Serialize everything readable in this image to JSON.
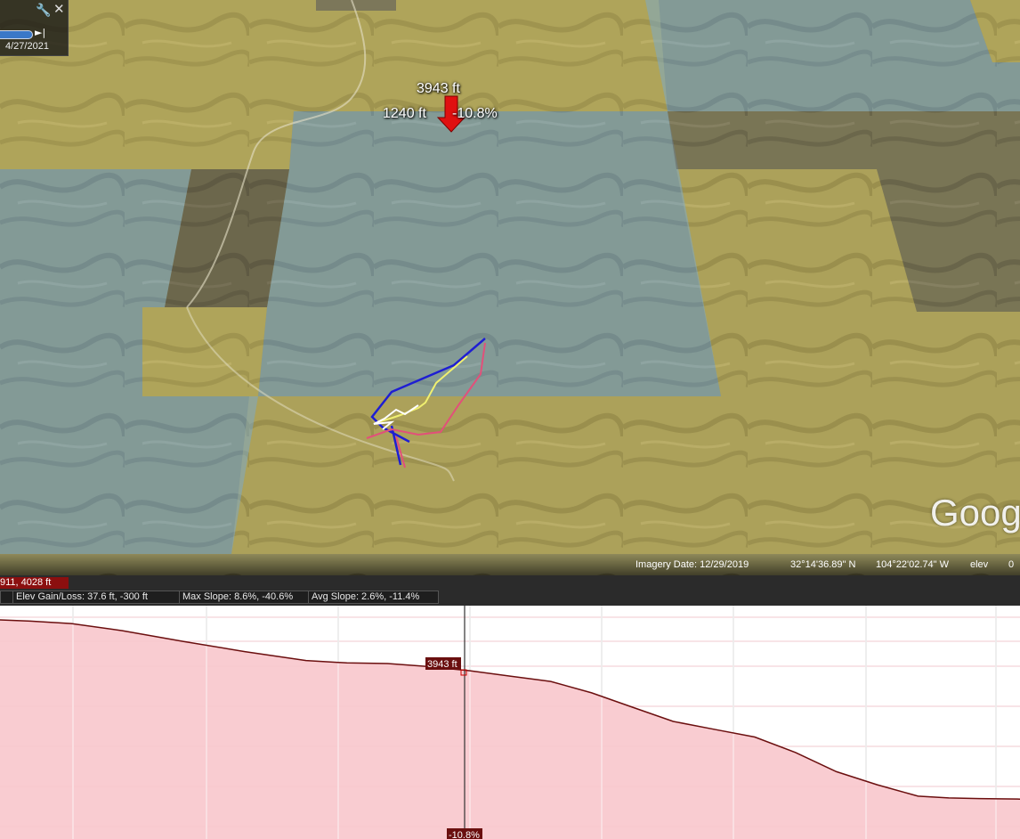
{
  "time_widget": {
    "date": "4/27/2021",
    "wrench_icon": "wrench-icon",
    "close_icon": "close-icon",
    "skip_icon": "skip-end-icon"
  },
  "pin": {
    "elevation": "3943 ft",
    "distance": "1240 ft",
    "slope": "-10.8%"
  },
  "watermark": "Goog",
  "status": {
    "imagery_date": "Imagery Date: 12/29/2019",
    "lat": "32°14'36.89\" N",
    "lon": "104°22'02.74\" W",
    "elev_label": "elev",
    "extra": "0"
  },
  "profile": {
    "range_chip": "911, 4028 ft",
    "elev_gain_loss": "Elev Gain/Loss: 37.6 ft, -300 ft",
    "max_slope": "Max Slope: 8.6%, -40.6%",
    "avg_slope": "Avg Slope: 2.6%, -11.4%",
    "cursor_elev": "3943 ft",
    "cursor_slope": "-10.8%"
  },
  "colors": {
    "profile_fill": "#f8c6cc",
    "profile_line": "#6b0f0f",
    "accent_red": "#8b0f0f"
  },
  "chart_data": {
    "type": "area",
    "x_units": "fraction of path",
    "x": [
      0.0,
      0.03,
      0.07,
      0.12,
      0.18,
      0.24,
      0.3,
      0.34,
      0.38,
      0.42,
      0.46,
      0.5,
      0.54,
      0.58,
      0.62,
      0.66,
      0.7,
      0.74,
      0.78,
      0.82,
      0.86,
      0.9,
      0.93,
      0.96,
      1.0
    ],
    "y": [
      4028,
      4026,
      4022,
      4010,
      3992,
      3975,
      3960,
      3956,
      3955,
      3950,
      3943,
      3934,
      3925,
      3906,
      3882,
      3858,
      3845,
      3832,
      3806,
      3774,
      3752,
      3733,
      3730,
      3729,
      3728
    ],
    "ylim": [
      3700,
      4040
    ],
    "grid": true
  }
}
